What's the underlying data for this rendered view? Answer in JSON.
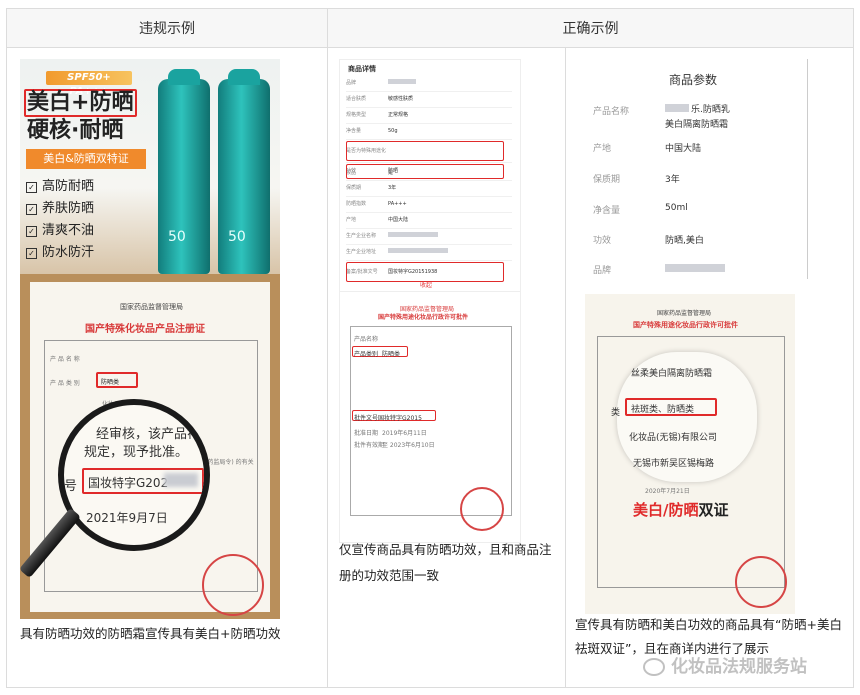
{
  "header": {
    "violation_label": "违规示例",
    "correct_label": "正确示例"
  },
  "product_ad": {
    "spf_badge": "SPF50+ PA+++",
    "headline_line1_a": "美白",
    "headline_plus": "+",
    "headline_line1_b": "防晒",
    "headline_line2": "硬核·耐晒",
    "banner": "美白&防晒双特证",
    "features": [
      "高防耐晒",
      "养肤防晒",
      "清爽不油",
      "防水防汗"
    ],
    "bottle_label": "50"
  },
  "cert_left": {
    "agency": "国家药品监督管理局",
    "title": "国产特殊化妆品产品注册证",
    "row_name": "产 品 名 称",
    "row_category": "产 品 类 别",
    "category_value": "防晒类",
    "row_company": "化妆品有限公司",
    "body_text": "经审核，该产品符合",
    "body_text2": "规定，现予批准。",
    "reg_label": "号",
    "reg_value": "国妆特字G202",
    "date": "2021年9月7日",
    "suffix_note": "(药监局令) 的有关"
  },
  "product_detail": {
    "title": "商品详情",
    "rows": [
      {
        "k": "品牌",
        "v": ""
      },
      {
        "k": "适合肤质",
        "v": "敏感性肤质"
      },
      {
        "k": "规格类型",
        "v": "正常规格"
      },
      {
        "k": "净含量",
        "v": "50g"
      },
      {
        "k": "是否为特殊用途化妆品",
        "v": "是"
      },
      {
        "k": "功效",
        "v": "防晒"
      },
      {
        "k": "保质期",
        "v": "3年"
      },
      {
        "k": "防晒指数",
        "v": "PA+++"
      },
      {
        "k": "产地",
        "v": "中国大陆"
      },
      {
        "k": "生产企业名称",
        "v": ""
      },
      {
        "k": "生产企业地址",
        "v": ""
      },
      {
        "k": "备案/批准文号",
        "v": "国妆特字G20151938"
      }
    ],
    "collapse": "收起"
  },
  "cert_middle": {
    "agency": "国家药品监督管理局",
    "title": "国产特殊用途化妆品行政许可批件",
    "row_name": "产品名称",
    "row_category": "产品类别",
    "category_value": "防晒类",
    "row_doc": "批件文号",
    "doc_value": "国妆特字G2015",
    "date_value": "2019年6月11日",
    "expire_value": "至 2023年6月10日",
    "row_date": "批准日期",
    "row_expire": "批件有效期"
  },
  "caption_middle": "仅宣传商品具有防晒功效，且和商品注册的功效范围一致",
  "params": {
    "title": "商品参数",
    "rows": [
      {
        "k": "产品名称",
        "v": "乐.防晒乳"
      },
      {
        "k": "",
        "v": "美白隔离防晒霜"
      },
      {
        "k": "产地",
        "v": "中国大陆"
      },
      {
        "k": "保质期",
        "v": "3年"
      },
      {
        "k": "净含量",
        "v": "50ml"
      },
      {
        "k": "功效",
        "v": "防晒,美白"
      },
      {
        "k": "品牌",
        "v": ""
      }
    ]
  },
  "cert_right": {
    "agency": "国家药品监督管理局",
    "title": "国产特殊用途化妆品行政许可批件",
    "row_name_value": "丝柔美白隔离防晒霜",
    "category_label": "类",
    "category_value": "祛斑类、防晒类",
    "company_value": "化妆品(无锡)有限公司",
    "address_value": "无锡市新吴区锡梅路",
    "date_value": "2020年7月21日",
    "overlay": "美白/防晒双证",
    "overlay_a": "美白/防晒",
    "overlay_b": "双证"
  },
  "caption_left": "具有防晒功效的防晒霜宣传具有美白+防晒功效",
  "caption_right": "宣传具有防晒和美白功效的商品具有“防晒+美白祛斑双证”，且在商详内进行了展示",
  "watermark": "化妆品法规服务站"
}
